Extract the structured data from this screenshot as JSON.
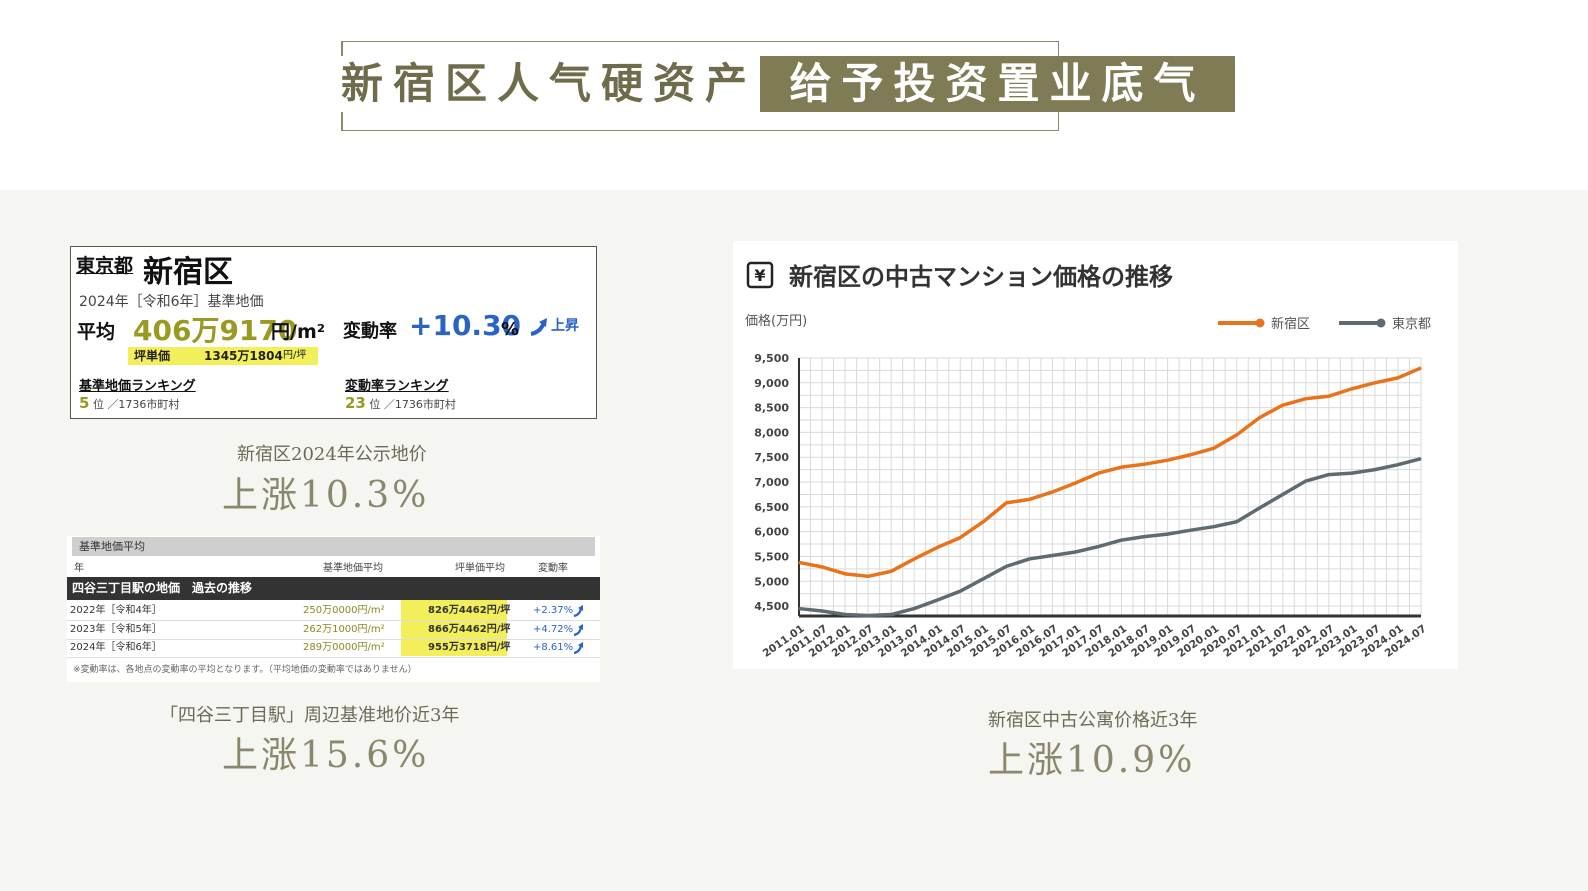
{
  "header": {
    "title_left": "新宿区人气硬资产",
    "title_right": "给予投资置业底气"
  },
  "card1": {
    "prefecture": "東京都",
    "ward": "新宿区",
    "year_label": "2024年［令和6年］基準地価",
    "avg_label": "平均",
    "avg_price": "406万9170",
    "avg_unit": "円/m²",
    "rate_label": "変動率",
    "rate_value": "+10.30",
    "rate_pct": "%",
    "rate_up": "上昇",
    "tsubo_label": "坪単価",
    "tsubo_value": "1345万1804",
    "tsubo_unit": "円/坪",
    "rank1_title": "基準地価ランキング",
    "rank1_num": "5",
    "rank1_suffix": "位 ／1736市町村",
    "rank2_title": "変動率ランキング",
    "rank2_num": "23",
    "rank2_suffix": "位 ／1736市町村"
  },
  "caption1": {
    "small": "新宿区2024年公示地价",
    "big": "上涨10.3%"
  },
  "table2": {
    "header_bar": "基準地価平均",
    "col_year": "年",
    "col_avg": "基準地価平均",
    "col_tsubo": "坪単価平均",
    "col_rate": "変動率",
    "dark_bar": "四谷三丁目駅の地価　過去の推移",
    "rows": [
      {
        "year": "2022年［令和4年］",
        "avg": "250万0000円/m²",
        "tsubo": "826万4462円/坪",
        "rate": "+2.37%"
      },
      {
        "year": "2023年［令和5年］",
        "avg": "262万1000円/m²",
        "tsubo": "866万4462円/坪",
        "rate": "+4.72%"
      },
      {
        "year": "2024年［令和6年］",
        "avg": "289万0000円/m²",
        "tsubo": "955万3718円/坪",
        "rate": "+8.61%"
      }
    ],
    "note": "※変動率は、各地点の変動率の平均となります。（平均地価の変動率ではありません）"
  },
  "caption2": {
    "small": "「四谷三丁目駅」周辺基准地价近3年",
    "big": "上涨15.6%"
  },
  "caption3": {
    "small": "新宿区中古公寓价格近3年",
    "big": "上涨10.9%"
  },
  "colors": {
    "olive": "#7e7b55",
    "shinjuku": "#e8731a",
    "tokyo": "#5f6b70"
  },
  "chart_data": {
    "type": "line",
    "title": "新宿区の中古マンション価格の推移",
    "icon": "yen-icon",
    "ylabel": "価格(万円)",
    "xlabel": "",
    "ylim": [
      4300,
      9500
    ],
    "yticks": [
      4500,
      5000,
      5500,
      6000,
      6500,
      7000,
      7500,
      8000,
      8500,
      9000,
      9500
    ],
    "ytick_labels": [
      "4,500",
      "5,000",
      "5,500",
      "6,000",
      "6,500",
      "7,000",
      "7,500",
      "8,000",
      "8,500",
      "9,000",
      "9,500"
    ],
    "categories": [
      "2011.01",
      "2011.07",
      "2012.01",
      "2012.07",
      "2013.01",
      "2013.07",
      "2014.01",
      "2014.07",
      "2015.01",
      "2015.07",
      "2016.01",
      "2016.07",
      "2017.01",
      "2017.07",
      "2018.01",
      "2018.07",
      "2019.01",
      "2019.07",
      "2020.01",
      "2020.07",
      "2021.01",
      "2021.07",
      "2022.01",
      "2022.07",
      "2023.01",
      "2023.07",
      "2024.01",
      "2024.07"
    ],
    "legend_position": "top-right",
    "grid": true,
    "series": [
      {
        "name": "新宿区",
        "color": "#e8731a",
        "values": [
          5380,
          5290,
          5150,
          5100,
          5200,
          5450,
          5680,
          5880,
          6200,
          6580,
          6650,
          6800,
          6980,
          7180,
          7300,
          7360,
          7440,
          7550,
          7680,
          7950,
          8300,
          8550,
          8680,
          8730,
          8880,
          9000,
          9100,
          9300
        ]
      },
      {
        "name": "東京都",
        "color": "#5f6b70",
        "values": [
          4450,
          4400,
          4330,
          4310,
          4330,
          4450,
          4620,
          4800,
          5050,
          5300,
          5450,
          5520,
          5590,
          5700,
          5830,
          5900,
          5950,
          6030,
          6100,
          6200,
          6480,
          6750,
          7020,
          7150,
          7180,
          7250,
          7350,
          7470
        ]
      }
    ]
  }
}
